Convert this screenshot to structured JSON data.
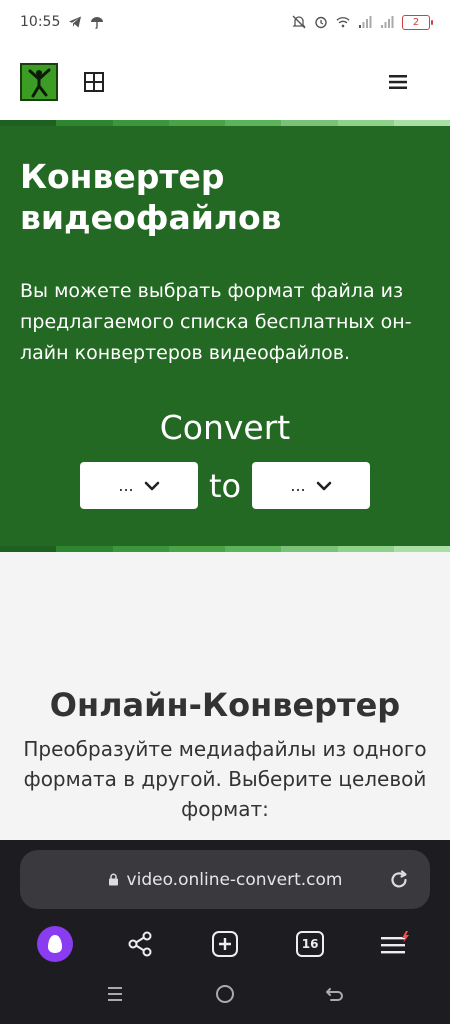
{
  "status_bar": {
    "time": "10:55",
    "battery": "2"
  },
  "hero": {
    "title": "Конвертер видеофайлов",
    "description": "Вы можете выбрать формат файла из предлагаемого списка бесплатных он-лайн конвертеров видеофайлов.",
    "convert_label": "Convert",
    "to_label": "to",
    "from_select": "...",
    "to_select": "..."
  },
  "content": {
    "title": "Онлайн-Конвертер",
    "description": "Преобразуйте медиафайлы из одного формата в другой. Выберите целевой формат:"
  },
  "browser": {
    "url": "video.online-convert.com",
    "tabs_count": "16"
  },
  "colors": {
    "hero_bg": "#236923",
    "accent_alice": "#8a3cf0",
    "battery_low": "#d04040"
  }
}
